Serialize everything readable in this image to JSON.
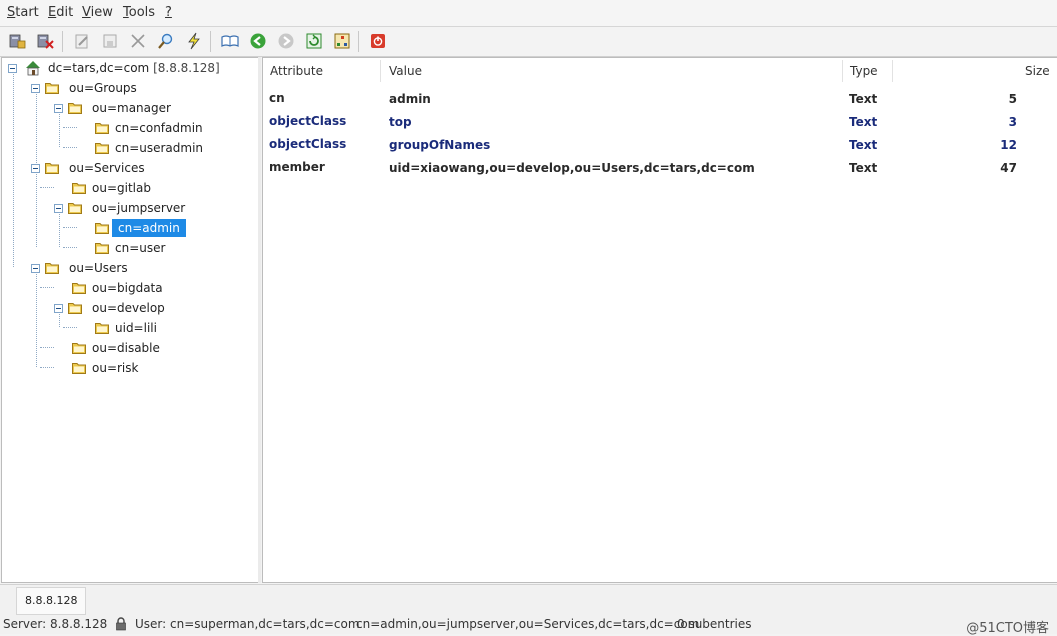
{
  "menu": {
    "items": [
      {
        "label": "Start",
        "key": "S",
        "rest": "tart"
      },
      {
        "label": "Edit",
        "key": "E",
        "rest": "dit"
      },
      {
        "label": "View",
        "key": "V",
        "rest": "iew"
      },
      {
        "label": "Tools",
        "key": "T",
        "rest": "ools"
      },
      {
        "label": "?",
        "key": "?",
        "rest": ""
      }
    ]
  },
  "toolbar": {
    "icons": [
      "connect-icon",
      "disconnect-icon",
      "edit-icon",
      "save-icon",
      "delete-icon",
      "search-icon",
      "lightning-icon",
      "book-icon",
      "back-icon",
      "forward-icon",
      "refresh-icon",
      "schema-icon",
      "exit-icon"
    ]
  },
  "tree": {
    "root_label": "dc=tars,dc=com",
    "root_server": "[8.8.8.128]",
    "nodes": [
      {
        "label": "ou=Groups"
      },
      {
        "label": "ou=manager"
      },
      {
        "label": "cn=confadmin"
      },
      {
        "label": "cn=useradmin"
      },
      {
        "label": "ou=Services"
      },
      {
        "label": "ou=gitlab"
      },
      {
        "label": "ou=jumpserver"
      },
      {
        "label": "cn=admin"
      },
      {
        "label": "cn=user"
      },
      {
        "label": "ou=Users"
      },
      {
        "label": "ou=bigdata"
      },
      {
        "label": "ou=develop"
      },
      {
        "label": "uid=lili"
      },
      {
        "label": "ou=disable"
      },
      {
        "label": "ou=risk"
      }
    ],
    "selected": "cn=admin"
  },
  "attributes": {
    "headers": {
      "attribute": "Attribute",
      "value": "Value",
      "type": "Type",
      "size": "Size"
    },
    "rows": [
      {
        "attribute": "cn",
        "value": "admin",
        "type": "Text",
        "size": "5"
      },
      {
        "attribute": "objectClass",
        "value": "top",
        "type": "Text",
        "size": "3"
      },
      {
        "attribute": "objectClass",
        "value": "groupOfNames",
        "type": "Text",
        "size": "12"
      },
      {
        "attribute": "member",
        "value": "uid=xiaowang,ou=develop,ou=Users,dc=tars,dc=com",
        "type": "Text",
        "size": "47"
      }
    ]
  },
  "status": {
    "server_tab": "8.8.8.128",
    "server": "Server: 8.8.8.128",
    "user": "User: cn=superman,dc=tars,dc=com",
    "dn": "cn=admin,ou=jumpserver,ou=Services,dc=tars,dc=com",
    "subentries": "0 subentries",
    "watermark": "@51CTO博客"
  },
  "colors": {
    "selection": "#1e8ae6",
    "objectclass_text": "#1a2b7a",
    "folder": "#e9c24a"
  }
}
